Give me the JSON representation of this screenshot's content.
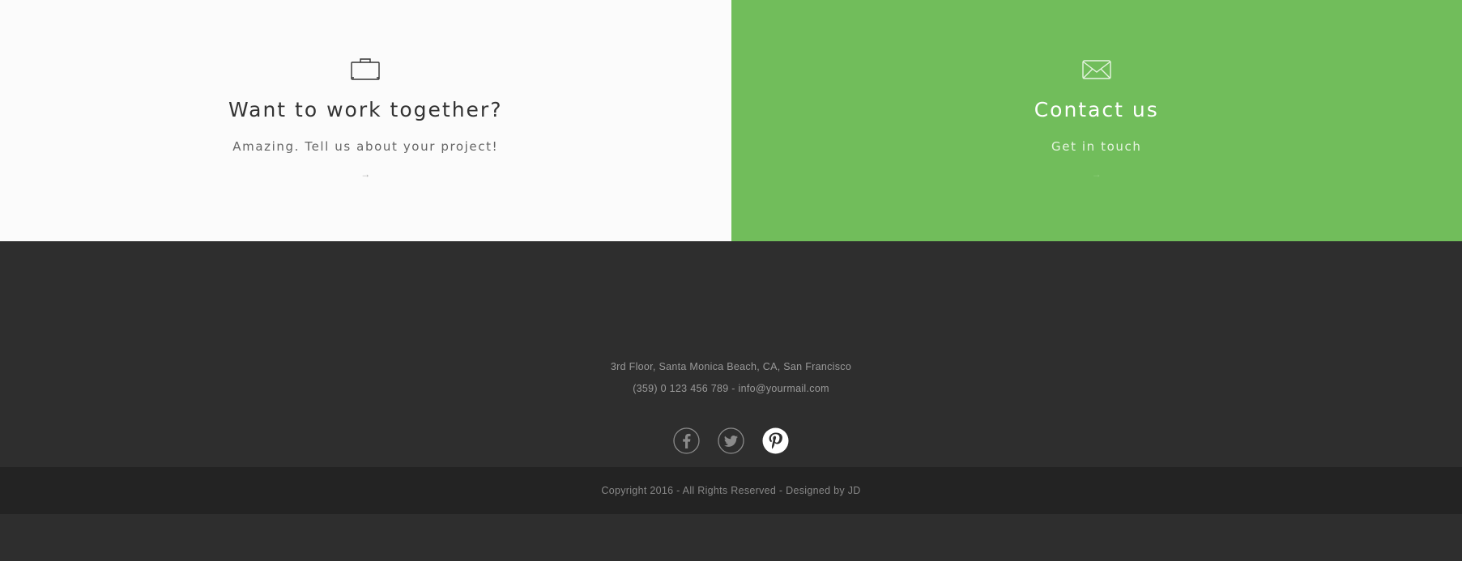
{
  "cta_left": {
    "icon": "briefcase-icon",
    "title": "Want to work together?",
    "subtitle": "Amazing. Tell us about your project!",
    "arrow": "→"
  },
  "cta_right": {
    "icon": "envelope-icon",
    "title": "Contact us",
    "subtitle": "Get in touch",
    "arrow": "→",
    "background": "#71bd5b"
  },
  "footer": {
    "address": "3rd Floor, Santa Monica Beach, CA, San Francisco",
    "phone": "(359) 0 123 456 789",
    "separator": " - ",
    "email": "info@yourmail.com",
    "social": [
      "facebook-icon",
      "twitter-icon",
      "pinterest-icon"
    ],
    "copyright": "Copyright 2016 - All Rights Reserved - Designed by JD",
    "background": "#2e2e2e"
  }
}
